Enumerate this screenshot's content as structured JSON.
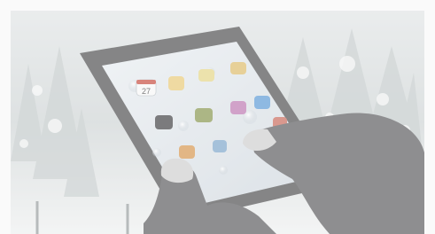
{
  "photo": {
    "subject": "tablet-with-gloved-hands",
    "palette": {
      "border": "#fafafa",
      "snow": "#e4e7e8",
      "tablet_bezel": "#3a3b3d",
      "screen": "#d6dde3",
      "glove": "#4a4a4c",
      "glove_tip": "#c9c9c9"
    },
    "screen_clock": "27"
  }
}
